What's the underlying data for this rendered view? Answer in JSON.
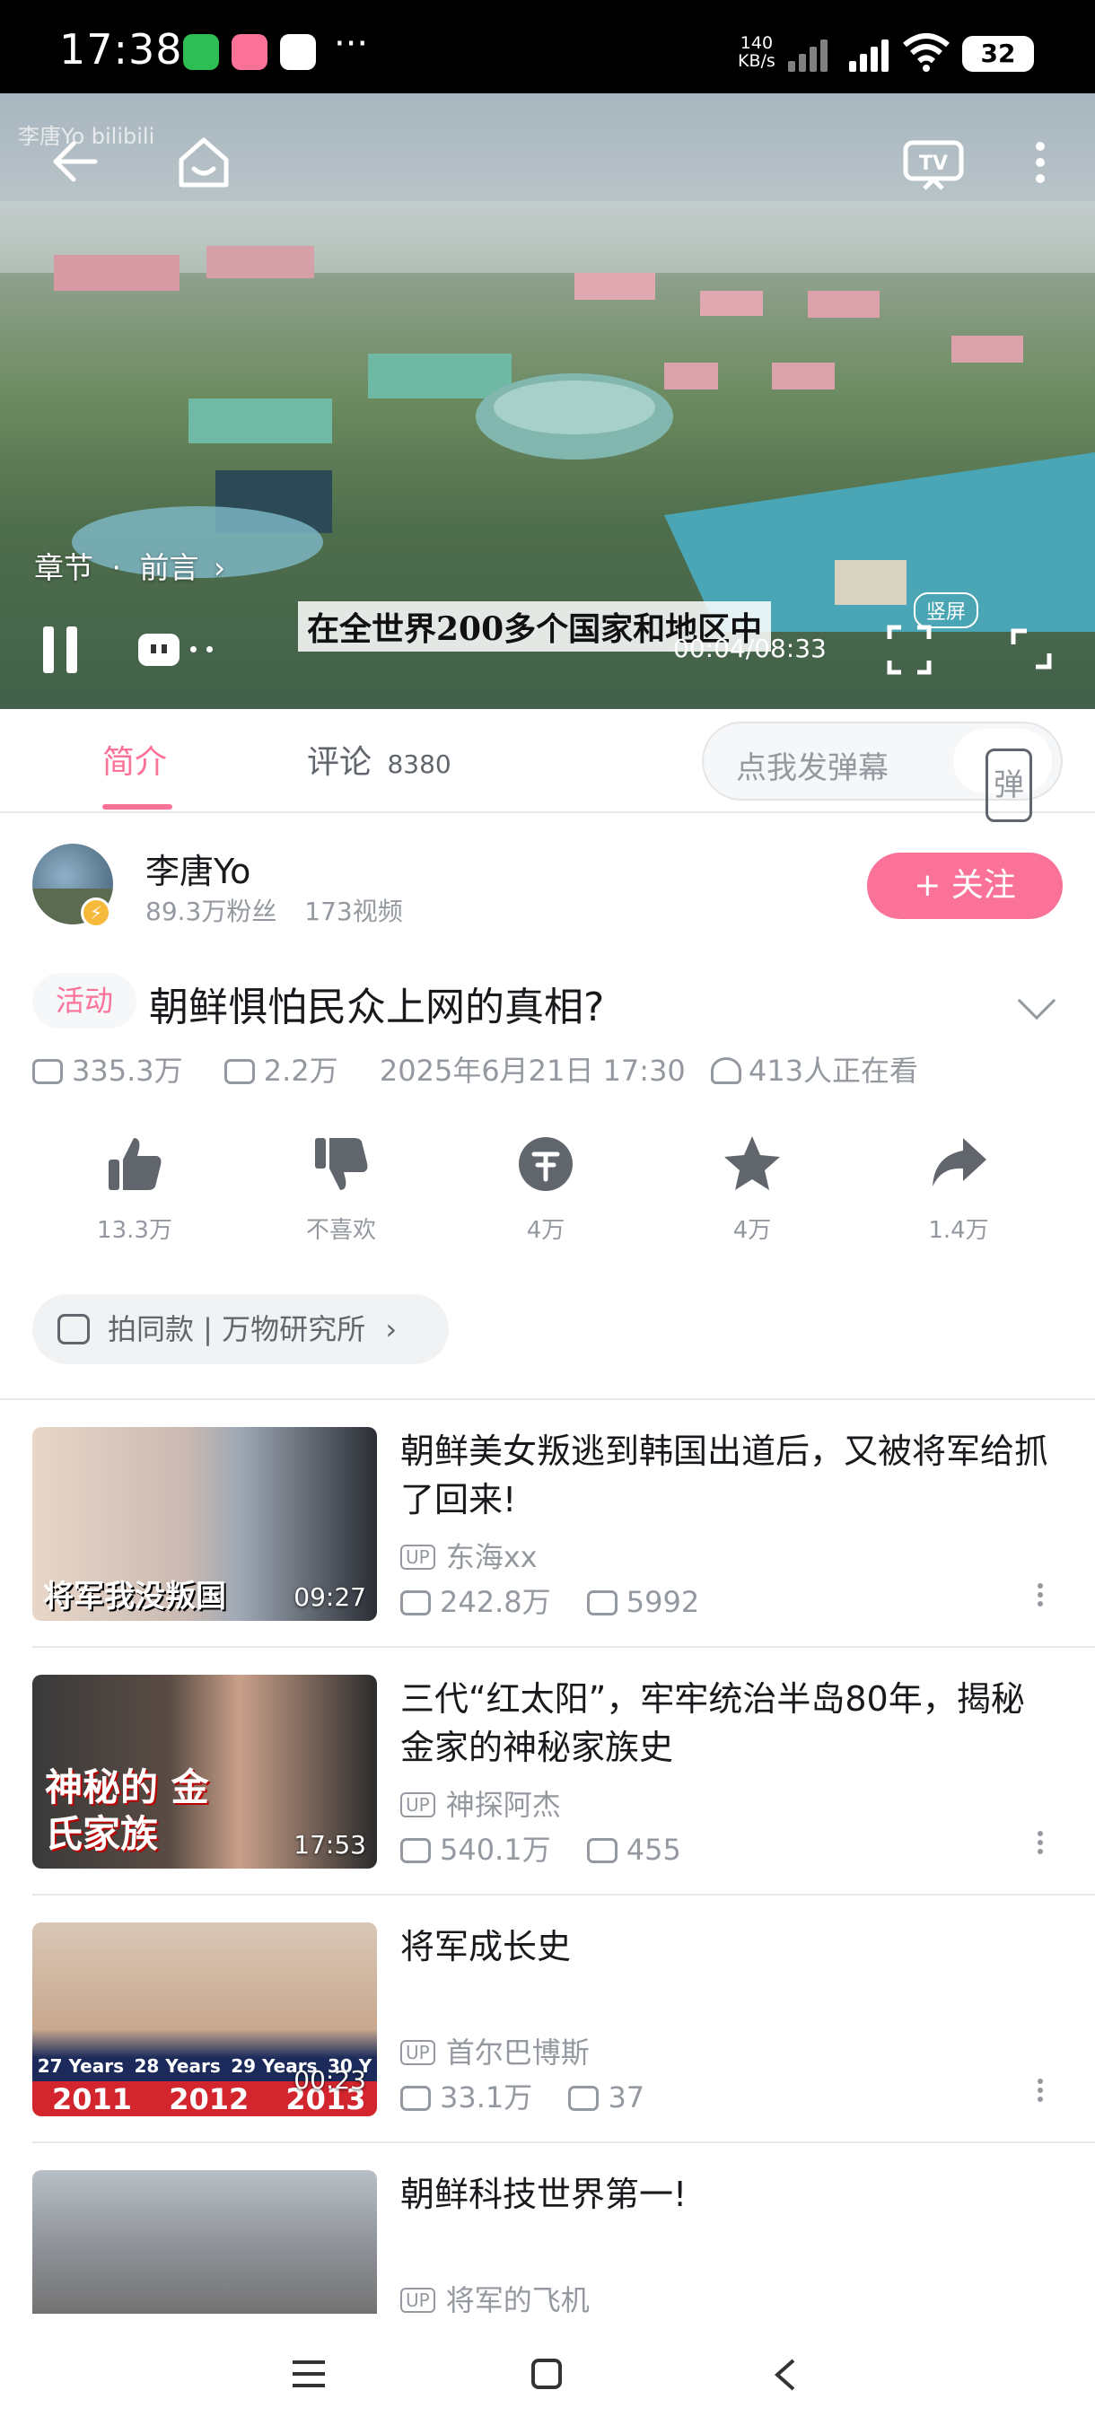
{
  "status_bar": {
    "time": "17:38",
    "more": "···",
    "net_speed": "140",
    "net_unit": "KB/s",
    "battery": "32"
  },
  "player": {
    "chapter_label": "章节",
    "chapter_sep": "·",
    "chapter_name": "前言",
    "subtitle_text": "在全世界200多个国家和地区中",
    "time_position": "00:04",
    "time_total": "08:33",
    "portrait_label": "竖屏"
  },
  "tabs": {
    "intro": "简介",
    "comments": "评论",
    "comments_count": "8380",
    "danmaku_placeholder": "点我发弹幕",
    "danmaku_button": "弹"
  },
  "uploader": {
    "name": "李唐Yo",
    "fans": "89.3万粉丝",
    "videos": "173视频",
    "follow_label": "+ 关注"
  },
  "video": {
    "tag": "活动",
    "title": "朝鲜惧怕民众上网的真相?",
    "views": "335.3万",
    "danmaku": "2.2万",
    "date": "2025年6月21日 17:30",
    "watching": "413人正在看"
  },
  "actions": {
    "like": "13.3万",
    "dislike": "不喜欢",
    "coin": "4万",
    "favorite": "4万",
    "share": "1.4万"
  },
  "same_style": "拍同款 | 万物研究所",
  "recommendations": [
    {
      "title": "朝鲜美女叛逃到韩国出道后，又被将军给抓了回来!",
      "thumb_text": "将军我没叛国",
      "duration": "09:27",
      "author": "东海xx",
      "views": "242.8万",
      "danmaku": "5992"
    },
    {
      "title": "三代“红太阳”，牢牢统治半岛80年，揭秘金家的神秘家族史",
      "thumb_text": "神秘的 金氏家族",
      "duration": "17:53",
      "author": "神探阿杰",
      "views": "540.1万",
      "danmaku": "455"
    },
    {
      "title": "将军成长史",
      "thumb_text": "2011 2012 2013",
      "duration": "00:23",
      "author": "首尔巴博斯",
      "views": "33.1万",
      "danmaku": "37"
    },
    {
      "title": "朝鲜科技世界第一!",
      "thumb_text": "",
      "duration": "",
      "author": "将军的飞机",
      "views": "",
      "danmaku": ""
    }
  ],
  "up_badge": "UP",
  "thumb_3_years": [
    "27 Years",
    "28 Years",
    "29 Years",
    "30 Y"
  ],
  "colors": {
    "accent": "#fb7299",
    "muted": "#9499a0"
  }
}
